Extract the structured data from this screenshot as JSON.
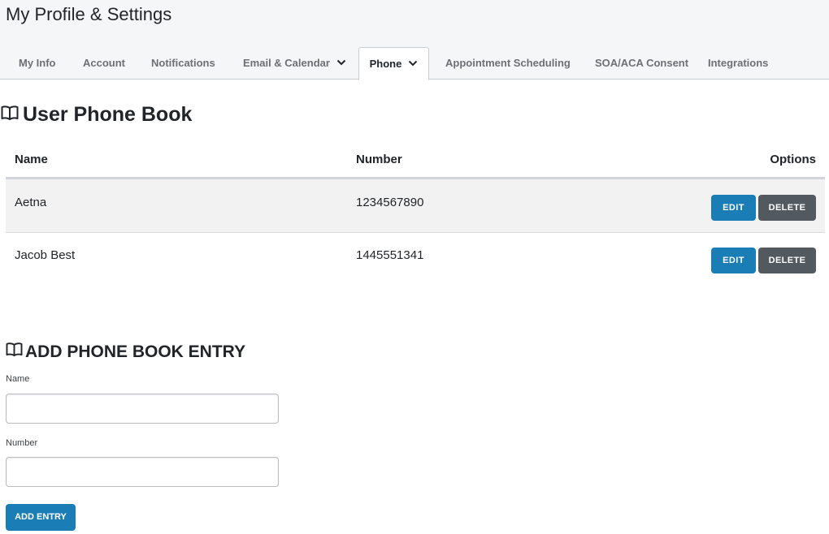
{
  "page": {
    "title": "My Profile & Settings"
  },
  "tabs": [
    {
      "label": "My Info"
    },
    {
      "label": "Account"
    },
    {
      "label": "Notifications"
    },
    {
      "label": "Email & Calendar",
      "has_dropdown": true
    },
    {
      "label": "Phone",
      "has_dropdown": true,
      "active": true
    },
    {
      "label": "Appointment Scheduling"
    },
    {
      "label": "SOA/ACA Consent"
    },
    {
      "label": "Integrations"
    }
  ],
  "phone_book": {
    "title": "User Phone Book",
    "icon": "book-open-icon",
    "columns": {
      "name": "Name",
      "number": "Number",
      "options": "Options"
    },
    "rows": [
      {
        "name": "Aetna",
        "number": "1234567890",
        "edit_label": "EDIT",
        "delete_label": "DELETE"
      },
      {
        "name": "Jacob Best",
        "number": "1445551341",
        "edit_label": "EDIT",
        "delete_label": "DELETE"
      }
    ]
  },
  "add_entry": {
    "title": "ADD PHONE BOOK ENTRY",
    "icon": "book-open-icon",
    "name_label": "Name",
    "name_value": "",
    "number_label": "Number",
    "number_value": "",
    "submit_label": "ADD ENTRY"
  },
  "colors": {
    "primary": "#1a7db5",
    "secondary": "#535a5f",
    "header_bg": "#f5f6f7",
    "row_shaded": "#f2f2f2"
  }
}
